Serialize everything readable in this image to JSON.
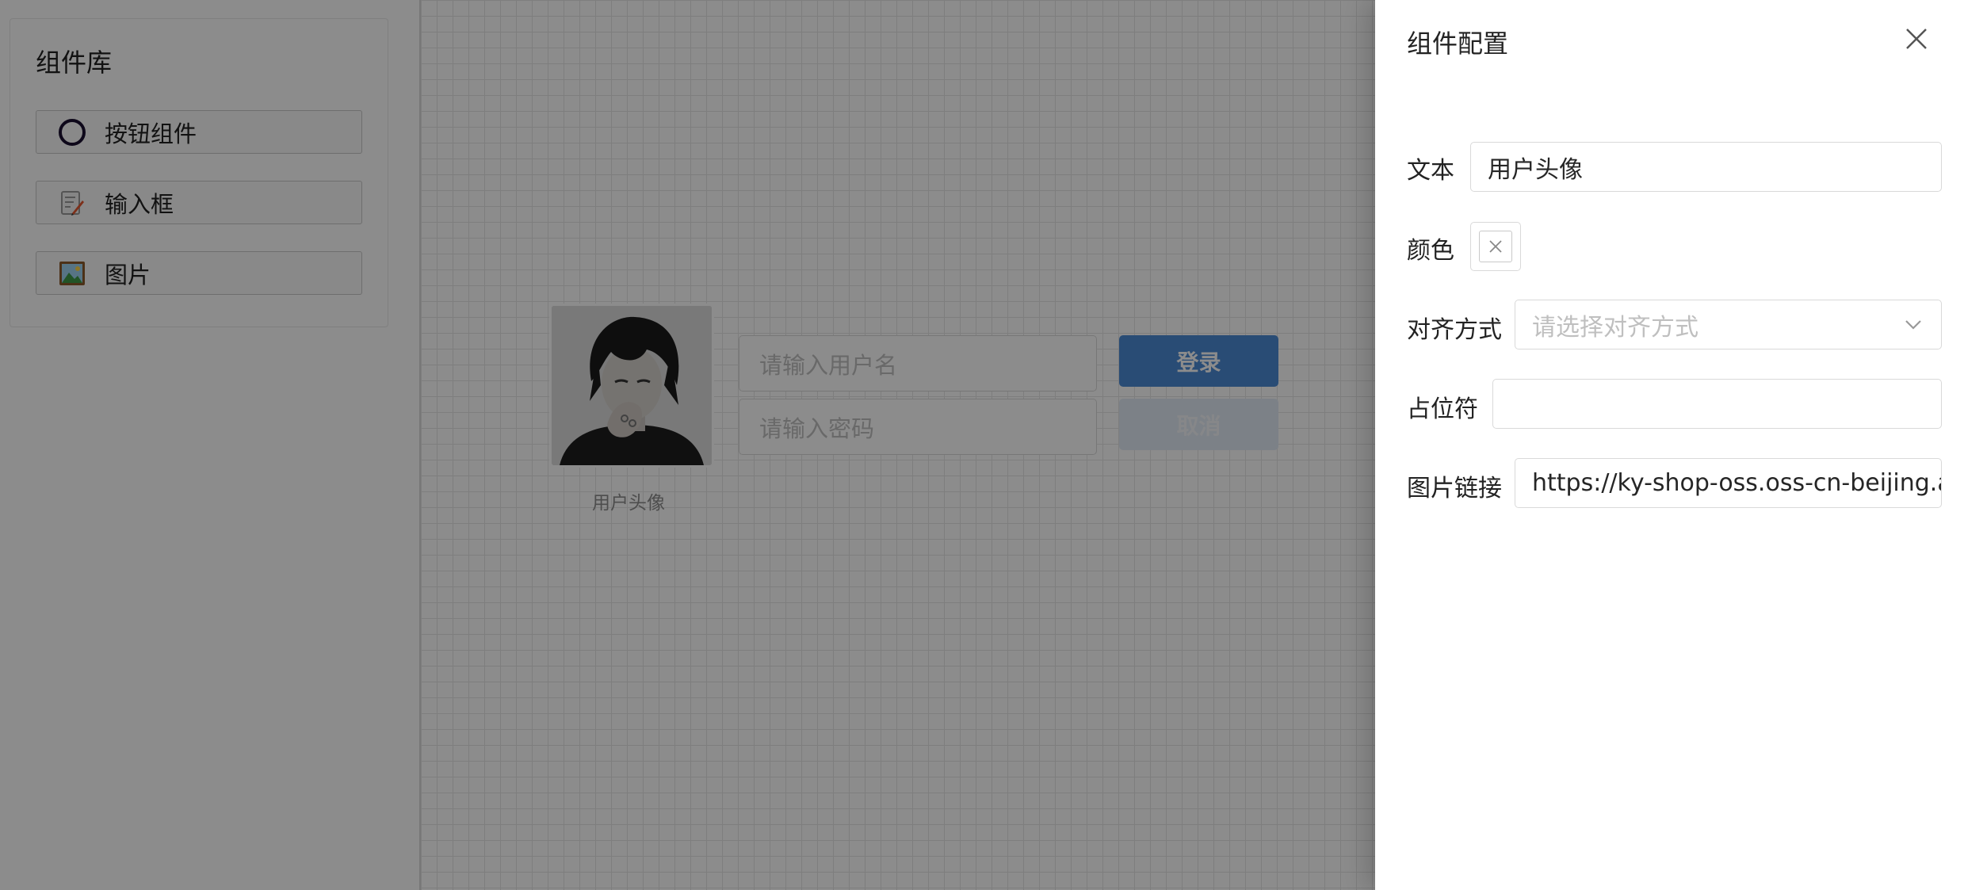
{
  "library": {
    "title": "组件库",
    "items": [
      {
        "label": "按钮组件",
        "icon": "circle-icon"
      },
      {
        "label": "输入框",
        "icon": "memo-icon"
      },
      {
        "label": "图片",
        "icon": "picture-icon"
      }
    ]
  },
  "canvas": {
    "avatar_caption": "用户头像",
    "username_placeholder": "请输入用户名",
    "password_placeholder": "请输入密码",
    "login_label": "登录",
    "cancel_label": "取消"
  },
  "drawer": {
    "title": "组件配置",
    "fields": {
      "text_label": "文本",
      "text_value": "用户头像",
      "color_label": "颜色",
      "align_label": "对齐方式",
      "align_placeholder": "请选择对齐方式",
      "placeholder_label": "占位符",
      "placeholder_value": "",
      "image_label": "图片链接",
      "image_value": "https://ky-shop-oss.oss-cn-beijing.ali"
    }
  },
  "colors": {
    "primary": "#4b8ad6",
    "mask": "rgba(0,0,0,0.45)"
  }
}
